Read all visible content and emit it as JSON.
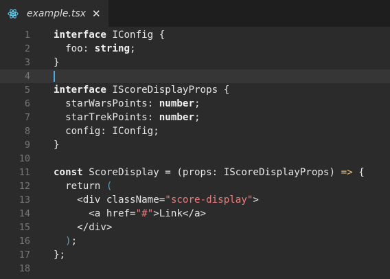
{
  "tab": {
    "title": "example.tsx",
    "close_glyph": "✕",
    "icon": "react-icon",
    "icon_color": "#61dafb"
  },
  "editor": {
    "current_line": 4,
    "lines": [
      {
        "number": "1",
        "tokens": [
          {
            "t": "interface",
            "c": "kw"
          },
          {
            "t": " IConfig {",
            "c": "plain"
          }
        ]
      },
      {
        "number": "2",
        "tokens": [
          {
            "t": "  foo: ",
            "c": "plain"
          },
          {
            "t": "string",
            "c": "type"
          },
          {
            "t": ";",
            "c": "plain"
          }
        ]
      },
      {
        "number": "3",
        "tokens": [
          {
            "t": "}",
            "c": "plain"
          }
        ]
      },
      {
        "number": "4",
        "tokens": []
      },
      {
        "number": "5",
        "tokens": [
          {
            "t": "interface",
            "c": "kw"
          },
          {
            "t": " IScoreDisplayProps {",
            "c": "plain"
          }
        ]
      },
      {
        "number": "6",
        "tokens": [
          {
            "t": "  starWarsPoints: ",
            "c": "plain"
          },
          {
            "t": "number",
            "c": "type"
          },
          {
            "t": ";",
            "c": "plain"
          }
        ]
      },
      {
        "number": "7",
        "tokens": [
          {
            "t": "  starTrekPoints: ",
            "c": "plain"
          },
          {
            "t": "number",
            "c": "type"
          },
          {
            "t": ";",
            "c": "plain"
          }
        ]
      },
      {
        "number": "8",
        "tokens": [
          {
            "t": "  config: IConfig;",
            "c": "plain"
          }
        ]
      },
      {
        "number": "9",
        "tokens": [
          {
            "t": "}",
            "c": "plain"
          }
        ]
      },
      {
        "number": "10",
        "tokens": []
      },
      {
        "number": "11",
        "tokens": [
          {
            "t": "const",
            "c": "kw"
          },
          {
            "t": " ScoreDisplay = (props: IScoreDisplayProps) ",
            "c": "plain"
          },
          {
            "t": "=>",
            "c": "arrow"
          },
          {
            "t": " {",
            "c": "plain"
          }
        ]
      },
      {
        "number": "12",
        "tokens": [
          {
            "t": "  return ",
            "c": "kw-light"
          },
          {
            "t": "(",
            "c": "paren-dim"
          }
        ]
      },
      {
        "number": "13",
        "tokens": [
          {
            "t": "    <div className=",
            "c": "plain"
          },
          {
            "t": "\"score-display\"",
            "c": "str"
          },
          {
            "t": ">",
            "c": "plain"
          }
        ]
      },
      {
        "number": "14",
        "tokens": [
          {
            "t": "      <a href=",
            "c": "plain"
          },
          {
            "t": "\"#\"",
            "c": "str"
          },
          {
            "t": ">Link</a>",
            "c": "plain"
          }
        ]
      },
      {
        "number": "15",
        "tokens": [
          {
            "t": "    </div>",
            "c": "plain"
          }
        ]
      },
      {
        "number": "16",
        "tokens": [
          {
            "t": "  )",
            "c": "paren-dim"
          },
          {
            "t": ";",
            "c": "plain"
          }
        ]
      },
      {
        "number": "17",
        "tokens": [
          {
            "t": "};",
            "c": "plain"
          }
        ]
      },
      {
        "number": "18",
        "tokens": []
      }
    ]
  },
  "colors": {
    "background": "#2b2b2b",
    "tabbar": "#1e1e1e",
    "line_number": "#767676",
    "text": "#e6e6e6",
    "string": "#f07b7b",
    "arrow": "#e8c06b",
    "paren": "#5fa0b8",
    "cursor": "#4fa9e0",
    "current_line": "#363636"
  }
}
